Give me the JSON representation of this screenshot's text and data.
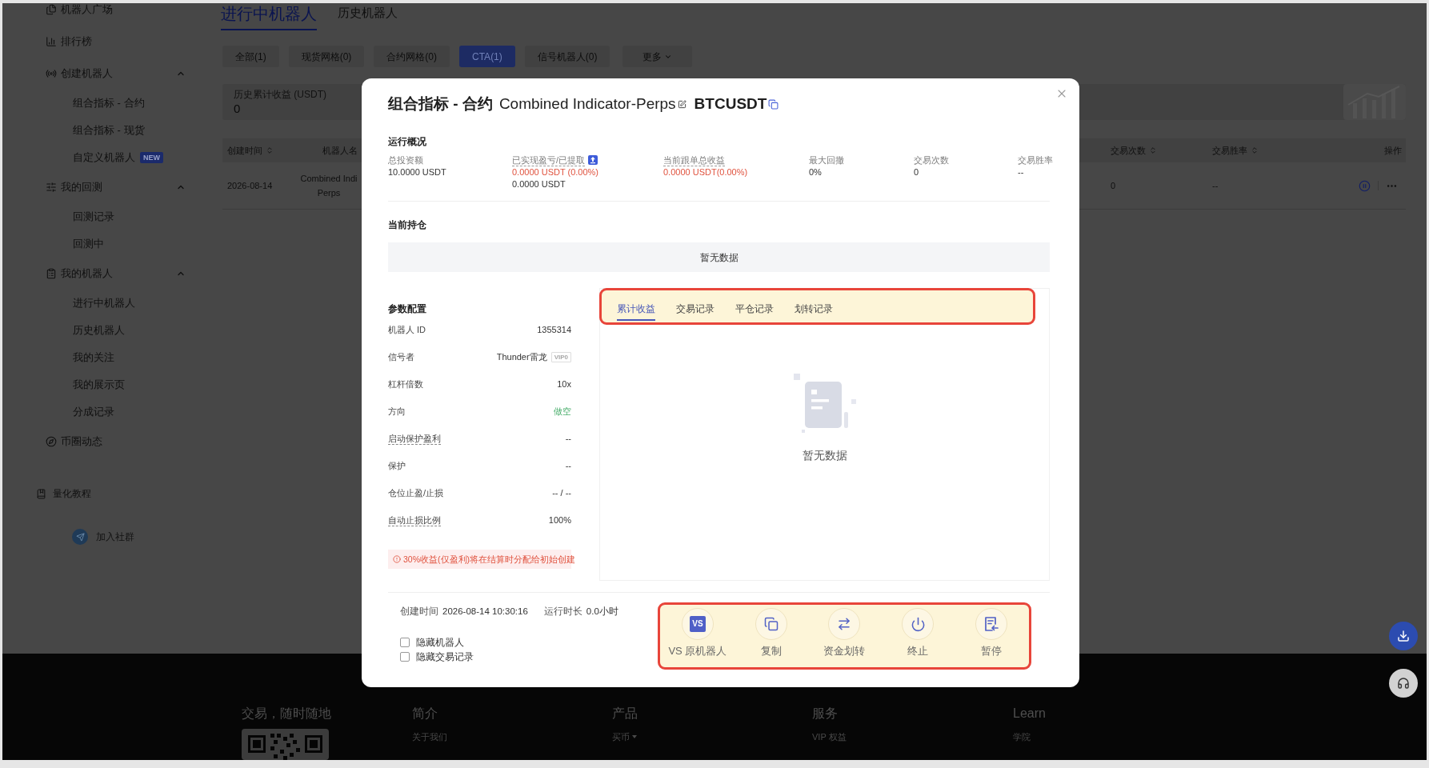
{
  "sidebar": {
    "items": [
      {
        "label": "机器人广场"
      },
      {
        "label": "排行榜"
      },
      {
        "label": "创建机器人",
        "expanded": true,
        "children": [
          {
            "label": "组合指标 - 合约"
          },
          {
            "label": "组合指标 - 现货"
          },
          {
            "label": "自定义机器人",
            "badge": "NEW"
          }
        ]
      },
      {
        "label": "我的回测",
        "expanded": true,
        "children": [
          {
            "label": "回测记录"
          },
          {
            "label": "回测中"
          }
        ]
      },
      {
        "label": "我的机器人",
        "expanded": true,
        "children": [
          {
            "label": "进行中机器人"
          },
          {
            "label": "历史机器人"
          },
          {
            "label": "我的关注"
          },
          {
            "label": "我的展示页"
          },
          {
            "label": "分成记录"
          }
        ]
      },
      {
        "label": "币圈动态"
      }
    ],
    "tutorial": "量化教程",
    "community": "加入社群"
  },
  "page_tabs": [
    {
      "label": "进行中机器人",
      "selected": true
    },
    {
      "label": "历史机器人",
      "selected": false
    }
  ],
  "filters": [
    {
      "label": "全部(1)",
      "selected": false
    },
    {
      "label": "现货网格(0)",
      "selected": false
    },
    {
      "label": "合约网格(0)",
      "selected": false
    },
    {
      "label": "CTA(1)",
      "selected": true
    },
    {
      "label": "信号机器人(0)",
      "selected": false
    }
  ],
  "more_filter": "更多",
  "summary": {
    "label": "历史累计收益 (USDT)",
    "value": "0"
  },
  "table": {
    "columns": [
      {
        "label": "创建时间",
        "sortable": true
      },
      {
        "label": "机器人名",
        "sortable": false
      },
      {
        "label": "交易次数",
        "sortable": true
      },
      {
        "label": "交易胜率",
        "sortable": true
      },
      {
        "label": "操作",
        "sortable": false
      }
    ],
    "rows": [
      {
        "created": "2026-08-14",
        "name": [
          "Combined Indi",
          "Perps"
        ],
        "trades": "0",
        "win_rate": "--"
      }
    ]
  },
  "modal": {
    "title": "组合指标 - 合约",
    "name": "Combined Indicator-Perps",
    "symbol": "BTCUSDT",
    "overview": {
      "heading": "运行概况",
      "stats": [
        {
          "label": "总投资额",
          "tooltip": false,
          "tip_icon": false,
          "values": [
            {
              "text": "10.0000 USDT",
              "kind": "plain"
            }
          ]
        },
        {
          "label": "已实现盈亏/已提取",
          "tooltip": true,
          "tip_icon": true,
          "values": [
            {
              "text": "0.0000 USDT (0.00%)",
              "kind": "pnl"
            },
            {
              "text": "0.0000 USDT",
              "kind": "plain"
            }
          ]
        },
        {
          "label": "当前跟单总收益",
          "tooltip": true,
          "tip_icon": false,
          "values": [
            {
              "text": "0.0000 USDT(0.00%)",
              "kind": "pnl"
            }
          ]
        },
        {
          "label": "最大回撤",
          "tooltip": false,
          "tip_icon": false,
          "values": [
            {
              "text": "0%",
              "kind": "plain"
            }
          ]
        },
        {
          "label": "交易次数",
          "tooltip": false,
          "tip_icon": false,
          "values": [
            {
              "text": "0",
              "kind": "plain"
            }
          ]
        },
        {
          "label": "交易胜率",
          "tooltip": false,
          "tip_icon": false,
          "values": [
            {
              "text": "--",
              "kind": "plain"
            }
          ]
        }
      ]
    },
    "positions": {
      "heading": "当前持仓",
      "empty": "暂无数据"
    },
    "params": {
      "heading": "参数配置",
      "rows": [
        {
          "label": "机器人 ID",
          "value": "1355314",
          "kind": "text",
          "tooltip": false
        },
        {
          "label": "信号者",
          "value": "Thunder雷龙",
          "badge": "VIP0",
          "kind": "text",
          "tooltip": false
        },
        {
          "label": "杠杆倍数",
          "value": "10x",
          "kind": "text",
          "tooltip": false
        },
        {
          "label": "方向",
          "value": "做空",
          "kind": "direction",
          "tooltip": false
        },
        {
          "label": "启动保护盈利",
          "value": "--",
          "kind": "text",
          "tooltip": true
        },
        {
          "label": "保护",
          "value": "--",
          "kind": "text",
          "tooltip": false
        },
        {
          "label": "仓位止盈/止损",
          "value": "-- / --",
          "kind": "text",
          "tooltip": false
        },
        {
          "label": "自动止损比例",
          "value": "100%",
          "kind": "text",
          "tooltip": true
        }
      ],
      "notice": "30%收益(仅盈利)将在结算时分配给初始创建"
    },
    "records": {
      "highlight": true,
      "tabs": [
        {
          "label": "累计收益",
          "selected": true
        },
        {
          "label": "交易记录",
          "selected": false
        },
        {
          "label": "平仓记录",
          "selected": false
        },
        {
          "label": "划转记录",
          "selected": false
        }
      ],
      "empty": "暂无数据"
    },
    "info": {
      "created_label": "创建时间",
      "created": "2026-08-14 10:30:16",
      "runtime_label": "运行时长",
      "runtime": "0.0小时"
    },
    "checkboxes": [
      {
        "label": "隐藏机器人",
        "checked": false
      },
      {
        "label": "隐藏交易记录",
        "checked": false
      }
    ],
    "actions": {
      "highlight": true,
      "items": [
        {
          "label": "VS 原机器人",
          "kind": "versus",
          "badge": "VS"
        },
        {
          "label": "复制",
          "kind": "copy"
        },
        {
          "label": "资金划转",
          "kind": "transfer"
        },
        {
          "label": "终止",
          "kind": "stop"
        },
        {
          "label": "暂停",
          "kind": "pause"
        }
      ]
    }
  },
  "footer": {
    "columns": [
      {
        "heading": "交易，随时随地",
        "kind": "app"
      },
      {
        "heading": "简介",
        "kind": "links",
        "links": [
          {
            "label": "关于我们",
            "dropdown": false
          }
        ]
      },
      {
        "heading": "产品",
        "kind": "links",
        "links": [
          {
            "label": "买币",
            "dropdown": true
          }
        ]
      },
      {
        "heading": "服务",
        "kind": "links",
        "links": [
          {
            "label": "VIP 权益",
            "dropdown": false
          }
        ]
      },
      {
        "heading": "Learn",
        "kind": "links",
        "links": [
          {
            "label": "学院",
            "dropdown": false
          }
        ]
      }
    ]
  }
}
